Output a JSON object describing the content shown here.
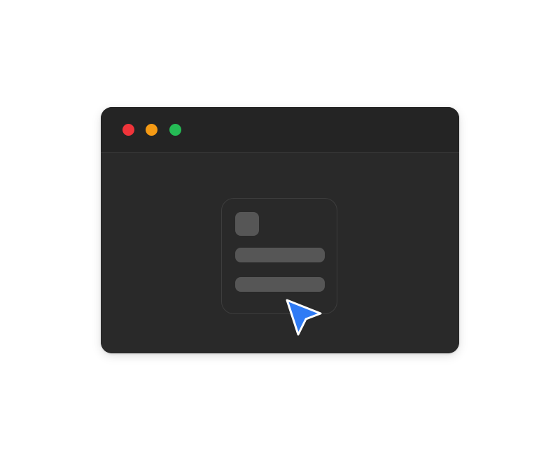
{
  "window": {
    "controls": {
      "close": {
        "icon": "close-dot-icon",
        "color": "#F0343A"
      },
      "minimize": {
        "icon": "minimize-dot-icon",
        "color": "#F59A14"
      },
      "maximize": {
        "icon": "maximize-dot-icon",
        "color": "#25BB55"
      }
    }
  },
  "content": {
    "document_icon": {
      "icon": "document-placeholder-icon",
      "fill_color": "#565656",
      "border_color": "#3D3D3D"
    },
    "cursor": {
      "icon": "mouse-pointer-icon",
      "color": "#2F7BF5"
    }
  },
  "theme": {
    "window_background": "#292929",
    "titlebar_background": "#242424",
    "page_background": "#FFFFFF"
  }
}
